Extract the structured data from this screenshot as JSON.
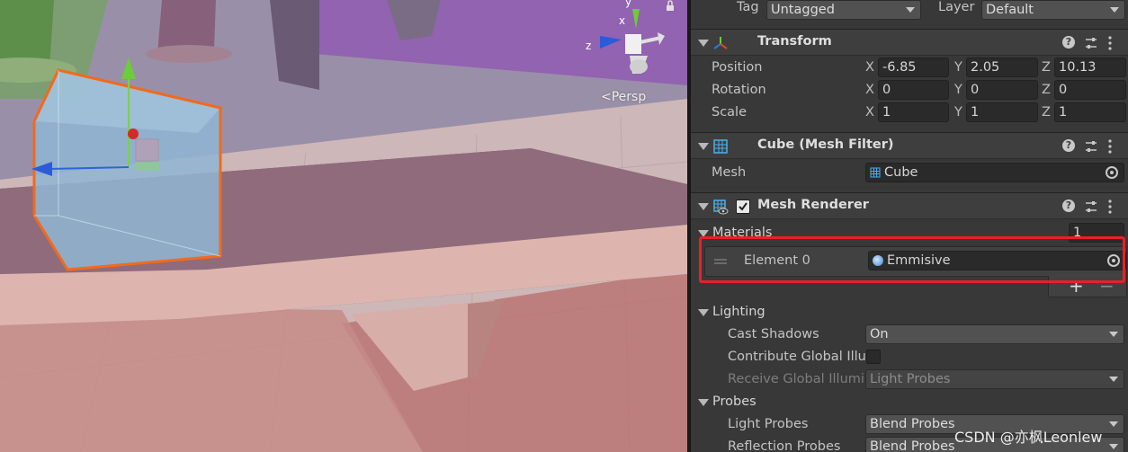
{
  "scene": {
    "persp_label": "<Persp",
    "gizmo_axes": {
      "y": "y",
      "x": "x",
      "z": "z"
    }
  },
  "header": {
    "tag_label": "Tag",
    "tag_value": "Untagged",
    "layer_label": "Layer",
    "layer_value": "Default"
  },
  "transform": {
    "title": "Transform",
    "position": {
      "label": "Position",
      "x": "-6.85",
      "y": "2.05",
      "z": "10.13"
    },
    "rotation": {
      "label": "Rotation",
      "x": "0",
      "y": "0",
      "z": "0"
    },
    "scale": {
      "label": "Scale",
      "x": "1",
      "y": "1",
      "z": "1"
    },
    "axis": {
      "x": "X",
      "y": "Y",
      "z": "Z"
    }
  },
  "mesh_filter": {
    "title": "Cube (Mesh Filter)",
    "mesh_label": "Mesh",
    "mesh_value": "Cube"
  },
  "mesh_renderer": {
    "title": "Mesh Renderer",
    "enabled": true,
    "materials_label": "Materials",
    "materials_count": "1",
    "element_label": "Element 0",
    "element_value": "Emmisive",
    "add": "+",
    "remove": "−",
    "lighting_label": "Lighting",
    "cast_shadows_label": "Cast Shadows",
    "cast_shadows_value": "On",
    "contribute_gi_label": "Contribute Global Illu",
    "contribute_gi_checked": false,
    "receive_gi_label": "Receive Global Illumi",
    "receive_gi_value": "Light Probes",
    "probes_label": "Probes",
    "light_probes_label": "Light Probes",
    "light_probes_value": "Blend Probes",
    "reflection_probes_label": "Reflection Probes",
    "reflection_probes_value": "Blend Probes"
  },
  "watermark": "CSDN @亦枫Leonlew",
  "colors": {
    "highlight": "#e8202a",
    "selection_outline": "#f26a1b",
    "inspector_bg": "#383838"
  }
}
